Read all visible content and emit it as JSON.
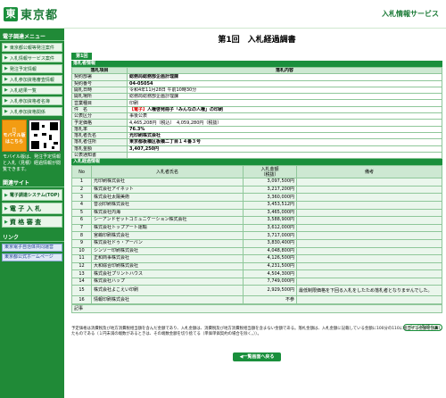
{
  "header": {
    "logo_mark": "東",
    "logo_text": "東京都",
    "service_title": "入札情報サービス"
  },
  "sidebar": {
    "menu_heading": "電子調達メニュー",
    "menu_items": [
      "東京都公報等発注案件",
      "入札情報サービス案件",
      "発注予定情報",
      "入札参加資格審査情報",
      "入札結果一覧",
      "入札参加資格者名簿",
      "入札参加資格関係"
    ],
    "mobile_label": "モバイル版はこちら",
    "note": "モバイル版は、発注予定情報と入札（見積）経過情報が閲覧できます。",
    "section2_heading": "関連サイト",
    "big_buttons": [
      "電子調達システム(TOP)",
      "電 子 入 札",
      "資 格 審 査"
    ],
    "section3_heading": "リンク",
    "links": [
      "東京電子自治体共同運営",
      "東京都公式ホームページ"
    ]
  },
  "main": {
    "title": "第1回　入札経過調書",
    "tab_label": "第1回",
    "info_section_title": "落札者情報",
    "info_headers": [
      "落札項目",
      "落札内容"
    ],
    "info_rows": [
      {
        "label": "契約部署",
        "value": "総務局総務部企画計理課",
        "bold": true
      },
      {
        "label": "契約番号",
        "value": "04-05054",
        "bold": true
      },
      {
        "label": "開札日時",
        "value": "令和4年11月28日 午前10時30分",
        "bold": false
      },
      {
        "label": "開札場所",
        "value": "総務局総務部企画計理課",
        "bold": false
      },
      {
        "label": "営業種目",
        "value": "印刷",
        "bold": false
      },
      {
        "label": "件　名",
        "badge": "【電子】",
        "value": "人権啓発冊子「みんなの人権」の印刷",
        "bold": true
      },
      {
        "label": "公表区分",
        "value": "事後公表",
        "bold": false
      },
      {
        "label": "予定価格",
        "value": "4,465,208円（税込）　4,059,280円（税抜）",
        "bold": false
      },
      {
        "label": "落札率",
        "value": "76.3%",
        "bold": true
      },
      {
        "label": "落札者氏名",
        "value": "光印刷株式会社",
        "bold": true
      },
      {
        "label": "落札者住所",
        "value": "東京都板橋区板橋二丁目１４番３号",
        "bold": true
      },
      {
        "label": "落札金額",
        "value": "3,407,250円",
        "bold": true
      },
      {
        "label": "公表通知書",
        "value": "",
        "bold": false
      }
    ],
    "bids_section_title": "入札経過情報",
    "bids_headers": {
      "no": "No",
      "name": "入札者氏名",
      "amount": "入札金額\n（税抜）",
      "remarks": "備考"
    },
    "bids": [
      {
        "no": "1",
        "name": "光印刷株式会社",
        "amount": "3,097,500円",
        "remarks": ""
      },
      {
        "no": "2",
        "name": "株式会社アイネット",
        "amount": "3,217,200円",
        "remarks": ""
      },
      {
        "no": "3",
        "name": "株式会社太陽美術",
        "amount": "3,360,000円",
        "remarks": ""
      },
      {
        "no": "4",
        "name": "音羽印刷株式会社",
        "amount": "3,453,512円",
        "remarks": ""
      },
      {
        "no": "5",
        "name": "株式会社内海",
        "amount": "3,465,000円",
        "remarks": ""
      },
      {
        "no": "6",
        "name": "シーアンドゼットコミュニケーション株式会社",
        "amount": "3,588,900円",
        "remarks": ""
      },
      {
        "no": "7",
        "name": "株式会社トップアート運輸",
        "amount": "3,612,000円",
        "remarks": ""
      },
      {
        "no": "8",
        "name": "宮嶋印刷株式会社",
        "amount": "3,717,000円",
        "remarks": ""
      },
      {
        "no": "9",
        "name": "株式会社ドゥ・アーバン",
        "amount": "3,830,400円",
        "remarks": ""
      },
      {
        "no": "10",
        "name": "シンソー印刷株式会社",
        "amount": "4,048,800円",
        "remarks": ""
      },
      {
        "no": "11",
        "name": "正和商事株式会社",
        "amount": "4,126,500円",
        "remarks": ""
      },
      {
        "no": "12",
        "name": "大和綜合印刷株式会社",
        "amount": "4,231,500円",
        "remarks": ""
      },
      {
        "no": "13",
        "name": "株式会社プリントハウス",
        "amount": "4,504,300円",
        "remarks": ""
      },
      {
        "no": "14",
        "name": "株式会社ハップ",
        "amount": "7,749,000円",
        "remarks": ""
      },
      {
        "no": "15",
        "name": "株式会社よこえい印刷",
        "amount": "2,929,500円",
        "remarks": "最低制限価格を下回る入札をしたため落札者となりませんでした。"
      },
      {
        "no": "16",
        "name": "情報印刷株式会社",
        "amount": "不参",
        "remarks": ""
      }
    ],
    "memo_label": "記事",
    "page_button": "ページ先頭へ",
    "footnote": "予定価格は消費税及び地方消費税相当額を含んだ金額であり、入札金額は、消費税及び地方消費税相当額を含まない金額である。落札金額は、入札金額に記載している金額に100分の110に相当する金額を加算したものである（１円未満の端数があるときは、その端数金額を切り捨てる（単価単価契約の場合を除く。））。",
    "back_button": "一覧画面へ戻る"
  }
}
